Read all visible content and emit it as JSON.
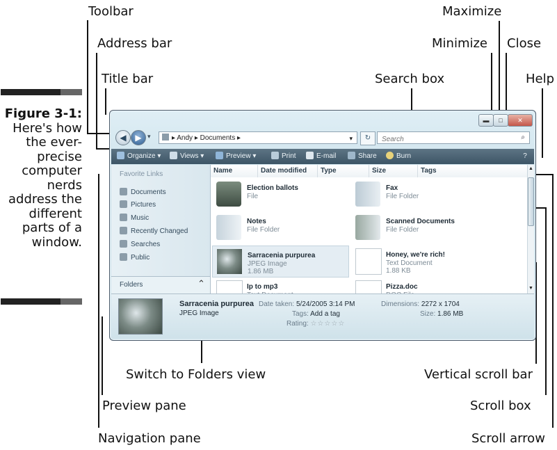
{
  "callouts": {
    "toolbar": "Toolbar",
    "address_bar": "Address bar",
    "title_bar": "Title bar",
    "maximize": "Maximize",
    "minimize": "Minimize",
    "close": "Close",
    "search_box": "Search box",
    "help": "Help",
    "switch_folders": "Switch to Folders view",
    "vertical_scroll": "Vertical scroll bar",
    "preview_pane": "Preview pane",
    "scroll_box": "Scroll box",
    "navigation_pane": "Navigation pane",
    "scroll_arrow": "Scroll arrow"
  },
  "figure": {
    "number": "Figure 3-1:",
    "caption": "Here's how the ever-precise computer nerds address the different parts of a window."
  },
  "window": {
    "breadcrumb": "▸ Andy ▸ Documents ▸",
    "search_placeholder": "Search",
    "toolbar": [
      "Organize ▾",
      "Views ▾",
      "Preview ▾",
      "Print",
      "E-mail",
      "Share",
      "Burn"
    ],
    "help_glyph": "?",
    "nav_heading": "Favorite Links",
    "nav_items": [
      "Documents",
      "Pictures",
      "Music",
      "Recently Changed",
      "Searches",
      "Public"
    ],
    "folders_label": "Folders",
    "columns": [
      "Name",
      "Date modified",
      "Type",
      "Size",
      "Tags"
    ],
    "files": [
      {
        "name": "Election ballots",
        "type": "File",
        "size": ""
      },
      {
        "name": "Fax",
        "type": "File Folder",
        "size": ""
      },
      {
        "name": "Notes",
        "type": "File Folder",
        "size": ""
      },
      {
        "name": "Scanned Documents",
        "type": "File Folder",
        "size": ""
      },
      {
        "name": "Sarracenia purpurea",
        "type": "JPEG Image",
        "size": "1.86 MB"
      },
      {
        "name": "Honey, we're rich!",
        "type": "Text Document",
        "size": "1.88 KB"
      },
      {
        "name": "Ip to mp3",
        "type": "Text Document",
        "size": ""
      },
      {
        "name": "Pizza.doc",
        "type": "DOC File",
        "size": ""
      }
    ],
    "preview": {
      "name": "Sarracenia purpurea",
      "type": "JPEG Image",
      "date_taken_label": "Date taken:",
      "date_taken": "5/24/2005 3:14 PM",
      "tags_label": "Tags:",
      "tags": "Add a tag",
      "rating_label": "Rating:",
      "rating_stars": "☆☆☆☆☆",
      "dimensions_label": "Dimensions:",
      "dimensions": "2272 x 1704",
      "size_label": "Size:",
      "size": "1.86 MB"
    }
  },
  "colors": {
    "toolbar": "#4a6172",
    "accent": "#d8e9f0"
  }
}
